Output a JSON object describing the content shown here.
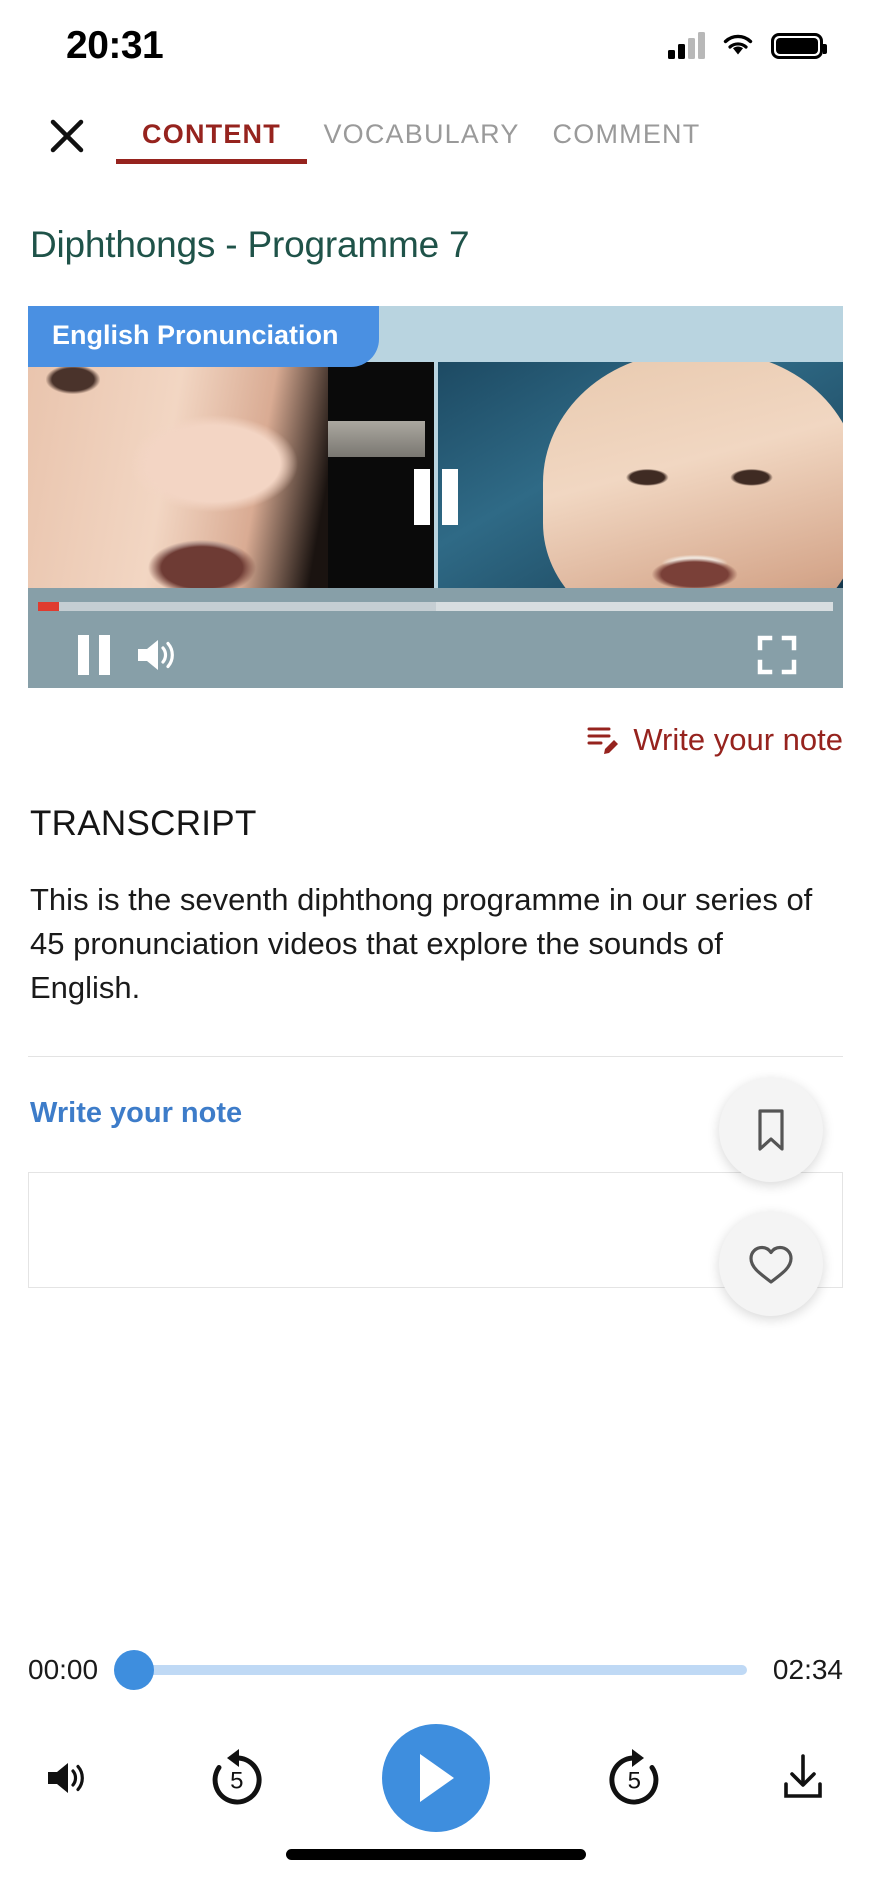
{
  "status_bar": {
    "time": "20:31",
    "signal_icon": "cellular-signal-icon",
    "wifi_icon": "wifi-icon",
    "battery_icon": "battery-full-icon"
  },
  "header": {
    "close_icon": "close-icon",
    "tabs": [
      {
        "label": "CONTENT",
        "active": true
      },
      {
        "label": "VOCABULARY",
        "active": false
      },
      {
        "label": "COMMENT",
        "active": false
      }
    ],
    "active_tab_color": "#96231e",
    "inactive_tab_color": "#9a9a9a"
  },
  "lesson": {
    "title": "Diphthongs - Programme 7",
    "title_color": "#1f5349"
  },
  "video": {
    "badge_label": "English Pronunciation",
    "badge_color": "#4a90e2",
    "state": "paused",
    "overlay_icon": "pause-icon",
    "controls": {
      "play_pause_icon": "pause-icon",
      "volume_icon": "volume-high-icon",
      "fullscreen_icon": "fullscreen-icon",
      "progress_percent": 2.6,
      "bar_color": "#879fa8",
      "played_color": "#e03b2f"
    }
  },
  "note_link": {
    "icon": "note-edit-icon",
    "label": "Write your note",
    "color": "#96231e"
  },
  "transcript": {
    "heading": "TRANSCRIPT",
    "body": "This is the seventh diphthong programme in our series of 45 pronunciation videos that explore the sounds of English."
  },
  "note_section": {
    "heading": "Write your note",
    "heading_color": "#3d7cc9",
    "textarea_value": "",
    "textarea_placeholder": ""
  },
  "floating_buttons": [
    {
      "name": "bookmark",
      "icon": "bookmark-icon"
    },
    {
      "name": "favourite",
      "icon": "heart-icon"
    }
  ],
  "audio_player": {
    "current_time": "00:00",
    "duration": "02:34",
    "progress_percent": 0,
    "accent_color": "#3e8ede",
    "track_color": "#bfd9f5",
    "buttons": {
      "volume_icon": "volume-high-icon",
      "rewind_icon": "rewind-5-icon",
      "rewind_label": "5",
      "play_icon": "play-icon",
      "forward_icon": "forward-5-icon",
      "forward_label": "5",
      "download_icon": "download-icon"
    }
  }
}
